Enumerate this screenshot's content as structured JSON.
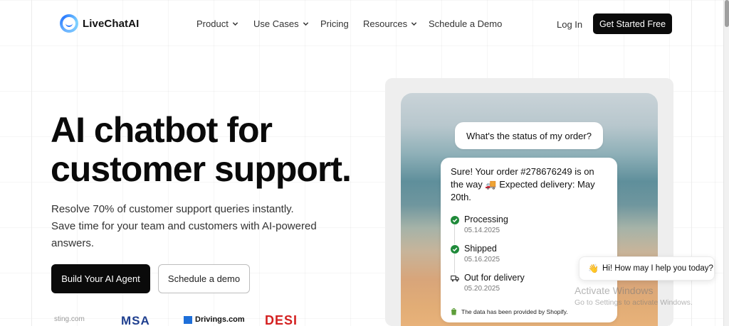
{
  "brand": {
    "name": "LiveChatAI"
  },
  "nav": {
    "items": [
      {
        "label": "Product",
        "dropdown": true
      },
      {
        "label": "Use Cases",
        "dropdown": true
      },
      {
        "label": "Pricing",
        "dropdown": false
      },
      {
        "label": "Resources",
        "dropdown": true
      },
      {
        "label": "Schedule a Demo",
        "dropdown": false
      }
    ],
    "login": "Log In",
    "cta": "Get Started Free"
  },
  "hero": {
    "title_line1": "AI chatbot for",
    "title_line2": "customer support.",
    "sub_line1": "Resolve 70% of customer support queries instantly.",
    "sub_line2": "Save time for your team and customers with AI-powered",
    "sub_line3": "answers.",
    "primary_button": "Build Your AI Agent",
    "secondary_button": "Schedule a demo"
  },
  "customer_logos": [
    "sting.com",
    "MSA",
    "Drivings.com",
    "DESI"
  ],
  "demo": {
    "question": "What's the status of my order?",
    "answer_line1": "Sure! Your order #278676249 is on",
    "answer_line2": "the way 🚚 Expected delivery: May",
    "answer_line3": "20th.",
    "steps": [
      {
        "label": "Processing",
        "date": "05.14.2025",
        "status": "done"
      },
      {
        "label": "Shipped",
        "date": "05.16.2025",
        "status": "done"
      },
      {
        "label": "Out for delivery",
        "date": "05.20.2025",
        "status": "pending"
      }
    ],
    "footer": "The data has been provided by Shopify."
  },
  "chat_widget": {
    "greeting": "Hi! How may I help you today?",
    "emoji": "👋"
  },
  "watermark": {
    "line1": "Activate Windows",
    "line2": "Go to Settings to activate Windows."
  },
  "colors": {
    "primary": "#0a0a0a",
    "check": "#1f8a3a",
    "accent": "#2b7bff"
  }
}
